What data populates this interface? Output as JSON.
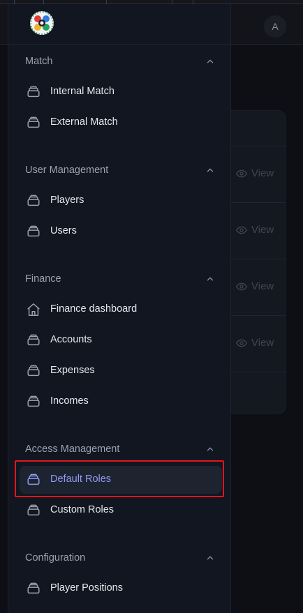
{
  "header": {
    "avatar_initial": "A"
  },
  "background": {
    "view_label": "View"
  },
  "sidebar": {
    "sections": [
      {
        "title": "Match",
        "items": [
          {
            "label": "Internal Match",
            "icon": "layers-icon"
          },
          {
            "label": "External Match",
            "icon": "layers-icon"
          }
        ]
      },
      {
        "title": "User Management",
        "items": [
          {
            "label": "Players",
            "icon": "layers-icon"
          },
          {
            "label": "Users",
            "icon": "layers-icon"
          }
        ]
      },
      {
        "title": "Finance",
        "items": [
          {
            "label": "Finance dashboard",
            "icon": "home-icon"
          },
          {
            "label": "Accounts",
            "icon": "layers-icon"
          },
          {
            "label": "Expenses",
            "icon": "layers-icon"
          },
          {
            "label": "Incomes",
            "icon": "layers-icon"
          }
        ]
      },
      {
        "title": "Access Management",
        "items": [
          {
            "label": "Default Roles",
            "icon": "layers-icon",
            "active": true
          },
          {
            "label": "Custom Roles",
            "icon": "layers-icon"
          }
        ]
      },
      {
        "title": "Configuration",
        "items": [
          {
            "label": "Player Positions",
            "icon": "layers-icon"
          }
        ]
      }
    ]
  },
  "colors": {
    "accent": "#8f9cf5",
    "highlight": "#e0161e",
    "sidebar_bg": "#111620"
  }
}
